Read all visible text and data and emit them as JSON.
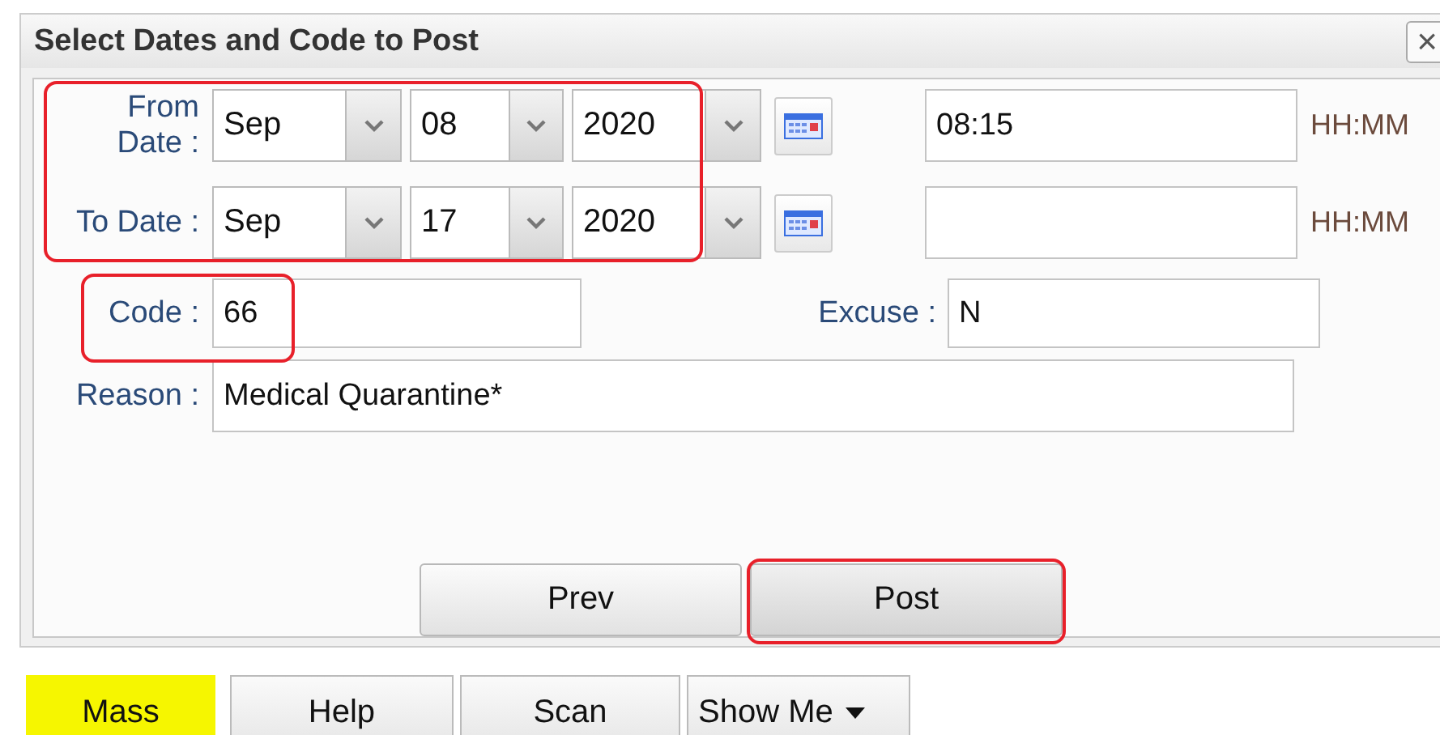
{
  "dialog": {
    "title": "Select Dates and Code to Post",
    "close": "×"
  },
  "date_rows": [
    {
      "label": "From Date :",
      "month": "Sep",
      "day": "08",
      "year": "2020",
      "time": "08:15",
      "time_format": "HH:MM"
    },
    {
      "label": "To Date :",
      "month": "Sep",
      "day": "17",
      "year": "2020",
      "time_format": "HH:MM"
    }
  ],
  "code": {
    "label": "Code :",
    "value": "66"
  },
  "excuse": {
    "label": "Excuse :",
    "value": "N"
  },
  "reason": {
    "label": "Reason :",
    "value": "Medical Quarantine*"
  },
  "buttons": [
    {
      "label": "Prev",
      "highlighted": false
    },
    {
      "label": "Post",
      "highlighted": true
    }
  ],
  "toolbar": [
    {
      "label": "Mass",
      "kind": "button",
      "selected": true
    },
    {
      "label": "Help",
      "kind": "button",
      "selected": false
    },
    {
      "label": "Scan",
      "kind": "button",
      "selected": false
    },
    {
      "label": "Show Me",
      "kind": "menu",
      "selected": false
    }
  ]
}
